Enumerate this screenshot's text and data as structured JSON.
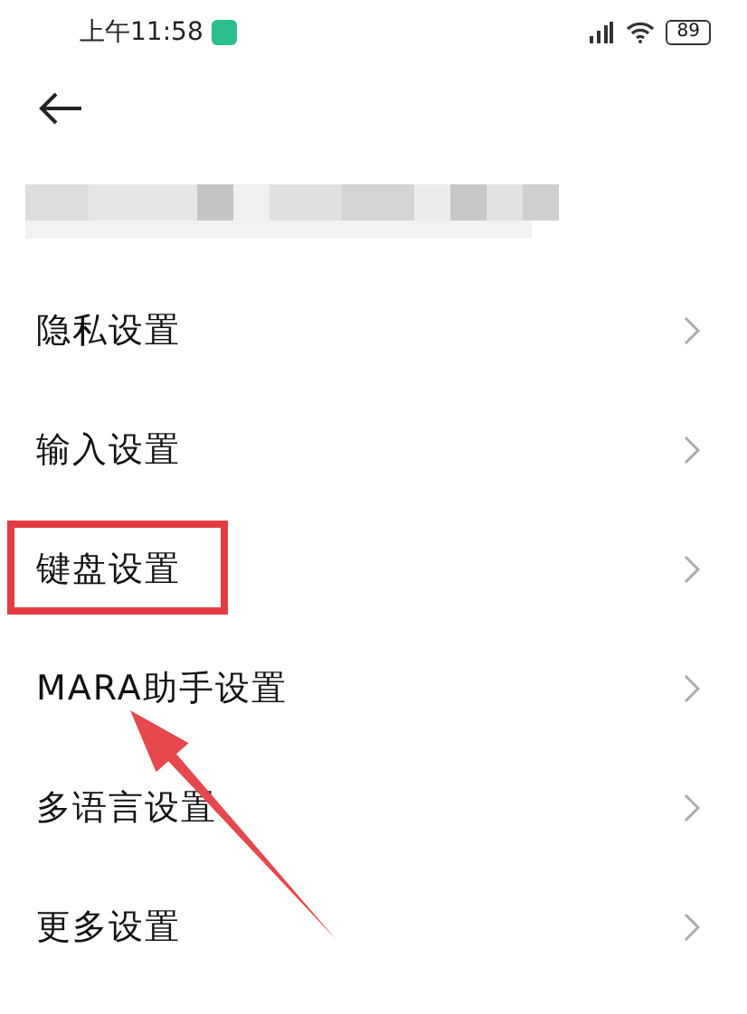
{
  "status_bar": {
    "time": "上午11:58",
    "battery": "89"
  },
  "settings": [
    {
      "label": "隐私设置",
      "highlighted": false
    },
    {
      "label": "输入设置",
      "highlighted": false
    },
    {
      "label": "键盘设置",
      "highlighted": true
    },
    {
      "label": "MARA助手设置",
      "highlighted": false
    },
    {
      "label": "多语言设置",
      "highlighted": false
    },
    {
      "label": "更多设置",
      "highlighted": false
    }
  ]
}
